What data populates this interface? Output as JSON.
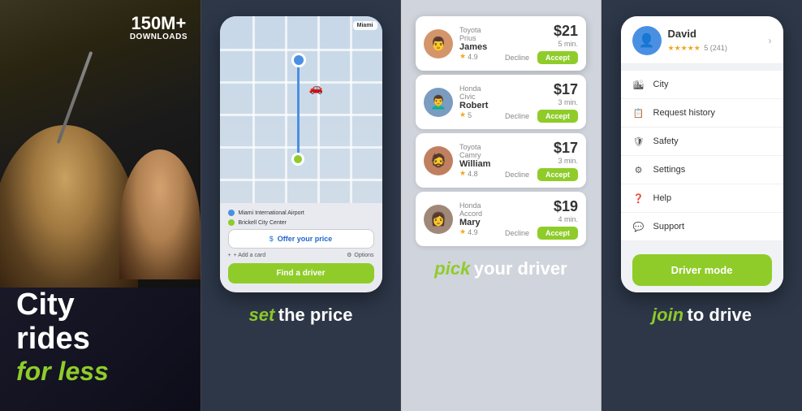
{
  "panel1": {
    "downloads": "150M+",
    "downloads_label": "DOWNLOADS",
    "headline_line1": "City",
    "headline_line2": "rides",
    "headline_accent": "for less"
  },
  "panel2": {
    "caption_italic": "set",
    "caption_normal": "the price",
    "map_label": "Miami",
    "location_from": "Miami International Airport",
    "location_to": "Brickell City Center",
    "offer_price_label": "Offer your price",
    "add_card_label": "+ Add a card",
    "options_label": "Options",
    "find_driver_label": "Find a driver"
  },
  "panel3": {
    "caption_italic": "pick",
    "caption_normal": "your driver",
    "drivers": [
      {
        "car": "Toyota Prius",
        "name": "James",
        "rating": "4.9",
        "price": "$21",
        "time": "5 min.",
        "avatar_emoji": "👨"
      },
      {
        "car": "Honda Civic",
        "name": "Robert",
        "rating": "5",
        "price": "$17",
        "time": "3 min.",
        "avatar_emoji": "👨‍🦱"
      },
      {
        "car": "Toyota Camry",
        "name": "William",
        "rating": "4.8",
        "price": "$17",
        "time": "3 min.",
        "avatar_emoji": "🧔"
      },
      {
        "car": "Honda Accord",
        "name": "Mary",
        "rating": "4.9",
        "price": "$19",
        "time": "4 min.",
        "avatar_emoji": "👩"
      }
    ],
    "decline_label": "Decline",
    "accept_label": "Accept"
  },
  "panel4": {
    "caption_italic": "join",
    "caption_normal": "to drive",
    "user_name": "David",
    "user_stars": "★★★★★",
    "user_reviews": "5 (241)",
    "menu_items": [
      {
        "icon": "🏙",
        "label": "City"
      },
      {
        "icon": "📋",
        "label": "Request history"
      },
      {
        "icon": "🛡",
        "label": "Safety"
      },
      {
        "icon": "⚙",
        "label": "Settings"
      },
      {
        "icon": "❓",
        "label": "Help"
      },
      {
        "icon": "💬",
        "label": "Support"
      }
    ],
    "driver_mode_label": "Driver mode"
  }
}
